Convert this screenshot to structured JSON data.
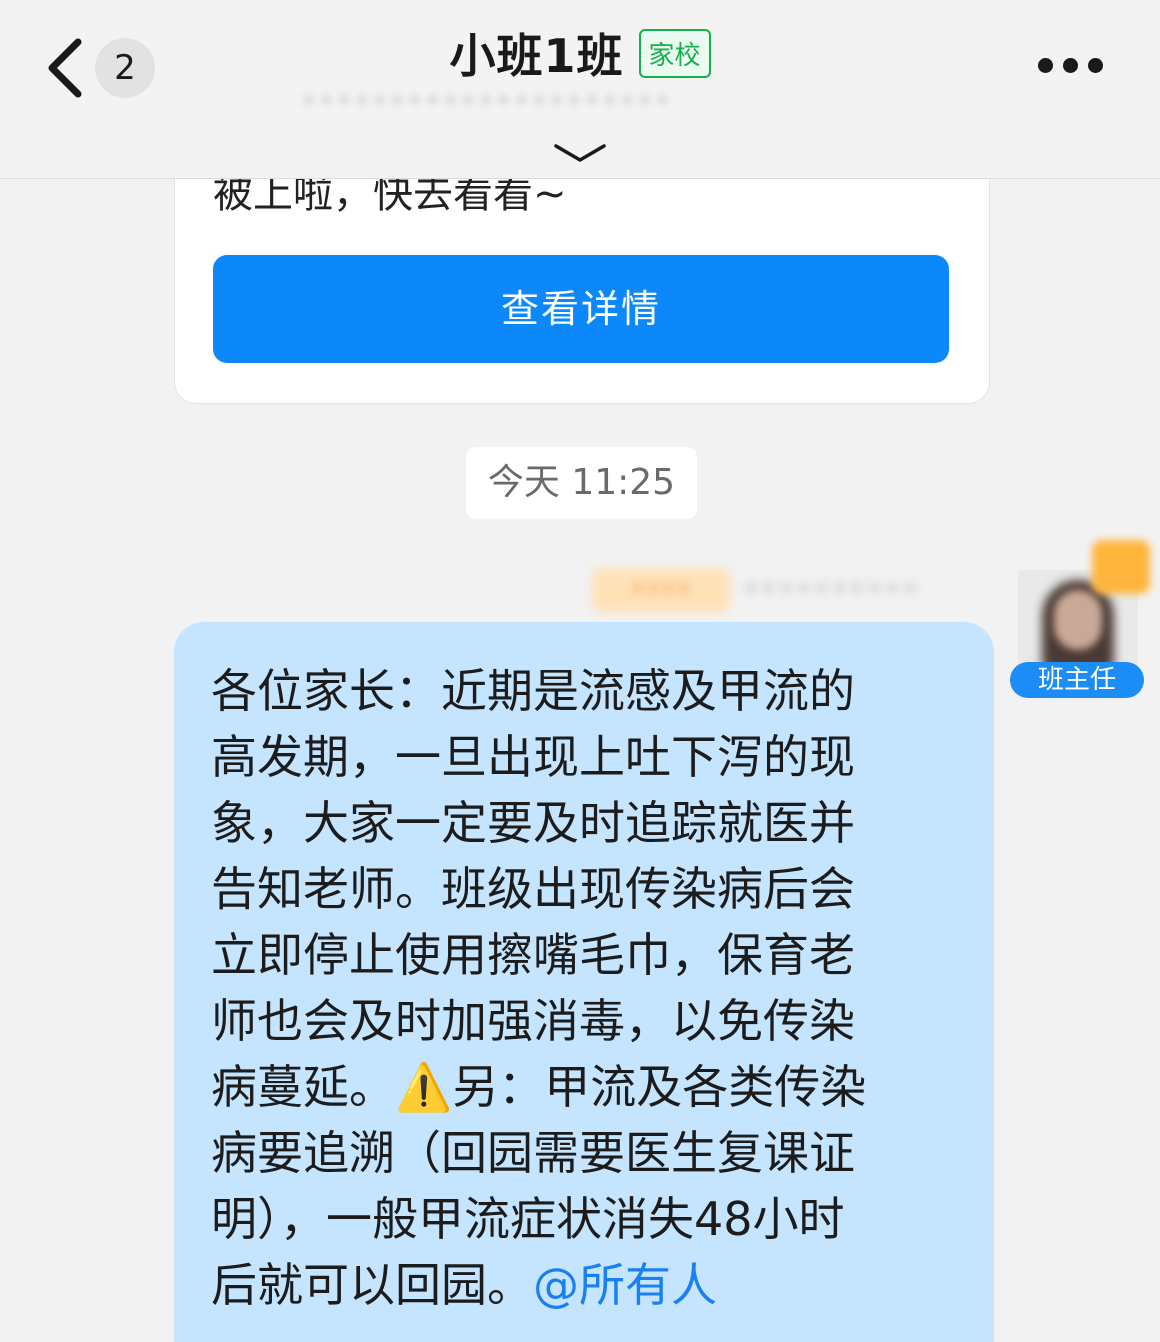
{
  "header": {
    "back_count": "2",
    "title": "小班1班",
    "tag": "家校",
    "subtitle": "•••••••••••••••••••••"
  },
  "card": {
    "text": "被上啦，快去看看~",
    "button_label": "查看详情"
  },
  "time_divider": "今天 11:25",
  "sender": {
    "tag": "••••",
    "name": "••••••••••",
    "role": "班主任"
  },
  "message": {
    "text_before_warning": "各位家长：近期是流感及甲流的\n高发期，一旦出现上吐下泻的现\n象，大家一定要及时追踪就医并\n告知老师。班级出现传染病后会\n立即停止使用擦嘴毛巾，保育老\n师也会及时加强消毒，以免传染\n病蔓延。",
    "warning_emoji": "⚠️",
    "text_after_warning": "另：甲流及各类传染\n病要追溯（回园需要医生复课证\n明），一般甲流症状消失48小时\n后就可以回园。",
    "mention": "@所有人"
  },
  "colors": {
    "accent_blue": "#0d88fb",
    "tag_green": "#17b04a",
    "bubble_blue": "#c5e4fe"
  }
}
